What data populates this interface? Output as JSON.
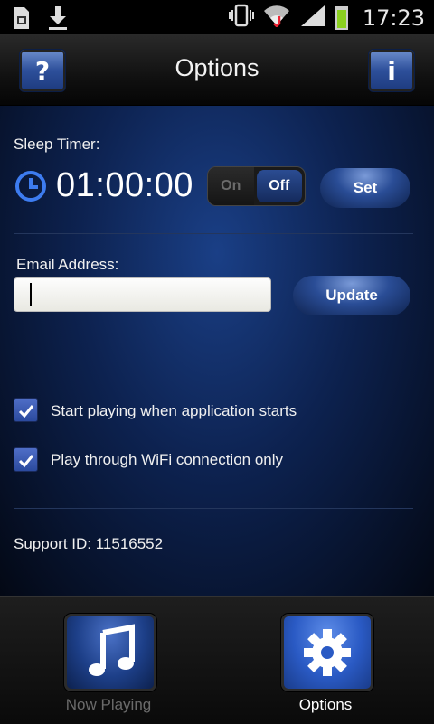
{
  "status_bar": {
    "time": "17:23",
    "icons": [
      "sim-icon",
      "download-icon",
      "vibrate-icon",
      "wifi-icon",
      "signal-icon",
      "battery-icon"
    ]
  },
  "header": {
    "title": "Options",
    "left_button_label": "?",
    "right_button_label": "i"
  },
  "sleep_timer": {
    "label": "Sleep Timer:",
    "value": "01:00:00",
    "toggle_on": "On",
    "toggle_off": "Off",
    "selected": "Off",
    "set_label": "Set"
  },
  "email": {
    "label": "Email Address:",
    "value": "",
    "placeholder": "",
    "update_label": "Update"
  },
  "options": [
    {
      "label": "Start playing when application starts",
      "checked": true
    },
    {
      "label": "Play through WiFi connection only",
      "checked": true
    }
  ],
  "support": {
    "text": "Support ID: 11516552"
  },
  "tabs": [
    {
      "label": "Now Playing",
      "icon": "music-note-icon",
      "active": false
    },
    {
      "label": "Options",
      "icon": "gear-icon",
      "active": true
    }
  ],
  "colors": {
    "accent": "#2a4d96",
    "background": "#0d2250",
    "toggle_active": "#2b4c92"
  }
}
